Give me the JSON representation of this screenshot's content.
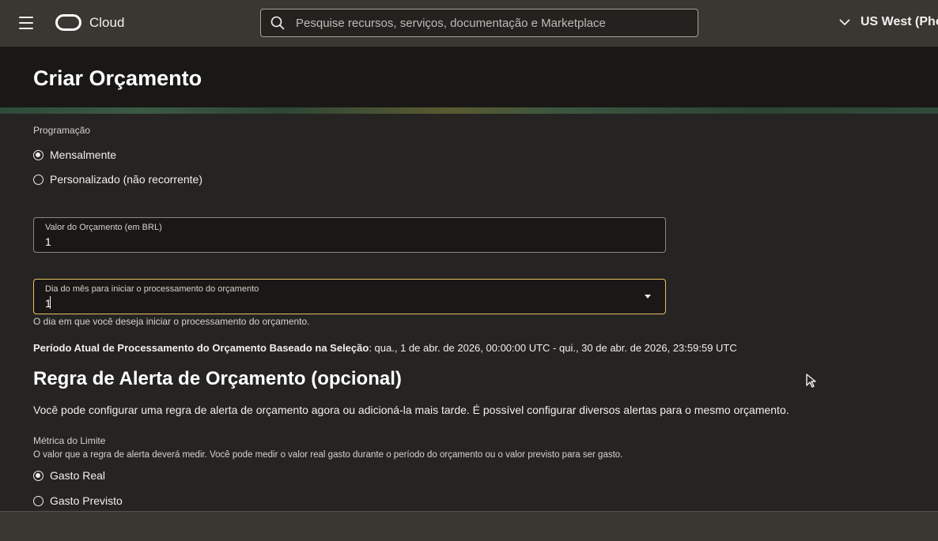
{
  "topbar": {
    "brand_label": "Cloud",
    "search_placeholder": "Pesquise recursos, serviços, documentação e Marketplace",
    "region_label": "US West (Pho"
  },
  "page": {
    "title": "Criar Orçamento"
  },
  "schedule": {
    "label": "Programação",
    "options": [
      {
        "label": "Mensalmente",
        "selected": true
      },
      {
        "label": "Personalizado (não recorrente)",
        "selected": false
      }
    ]
  },
  "budget_amount": {
    "label": "Valor do Orçamento (em BRL)",
    "value": "1"
  },
  "start_day": {
    "label": "Dia do mês para iniciar o processamento do orçamento",
    "value": "1",
    "helper": "O dia em que você deseja iniciar o processamento do orçamento."
  },
  "period": {
    "label": "Período Atual de Processamento do Orçamento Baseado na Seleção",
    "value": ": qua., 1 de abr. de 2026, 00:00:00 UTC - qui., 30 de abr. de 2026, 23:59:59 UTC"
  },
  "alert_rule": {
    "title": "Regra de Alerta de Orçamento (opcional)",
    "description": "Você pode configurar uma regra de alerta de orçamento agora ou adicioná-la mais tarde. É possível configurar diversos alertas para o mesmo orçamento.",
    "metric_label": "Métrica do Limite",
    "metric_description": "O valor que a regra de alerta deverá medir. Você pode medir o valor real gasto durante o período do orçamento ou o valor previsto para ser gasto.",
    "options": [
      {
        "label": "Gasto Real",
        "selected": true
      },
      {
        "label": "Gasto Previsto",
        "selected": false
      }
    ]
  }
}
